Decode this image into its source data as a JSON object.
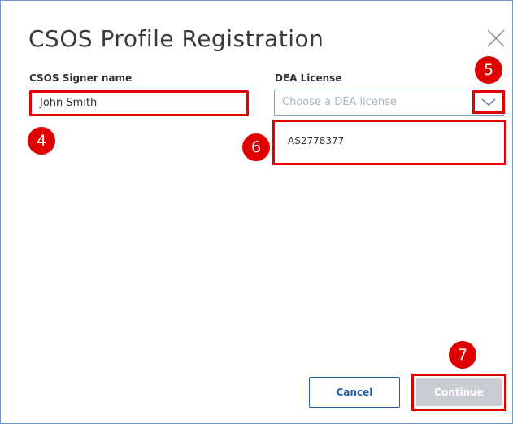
{
  "dialog": {
    "title": "CSOS Profile Registration"
  },
  "signer": {
    "label": "CSOS Signer name",
    "value": "John Smith"
  },
  "dea": {
    "label": "DEA License",
    "placeholder": "Choose a DEA license",
    "option": "AS2778377"
  },
  "callouts": {
    "four": "4",
    "five": "5",
    "six": "6",
    "seven": "7"
  },
  "buttons": {
    "cancel": "Cancel",
    "continue": "Continue"
  },
  "icons": {
    "close": "close-icon",
    "dropdown": "chevron-down-icon"
  },
  "colors": {
    "highlight": "#e00000",
    "primary": "#1f5fa8",
    "disabled": "#c9cdd3",
    "dialog_border": "#6f95c4"
  }
}
